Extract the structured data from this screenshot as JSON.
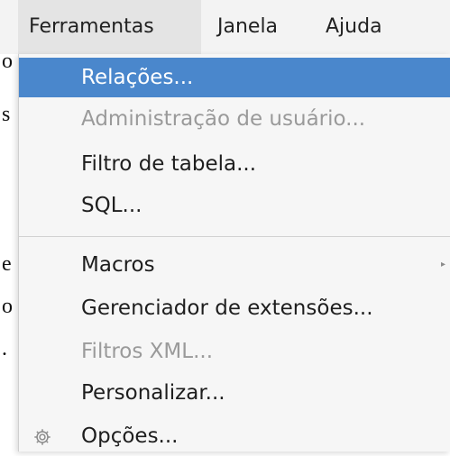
{
  "background_document": {
    "fragments": [
      "o",
      "s",
      "e",
      "o",
      "."
    ]
  },
  "menubar": {
    "items": [
      {
        "label": "Ferramentas",
        "active": true
      },
      {
        "label": "Janela",
        "active": false
      },
      {
        "label": "Ajuda",
        "active": false
      }
    ]
  },
  "tools_menu": {
    "items": [
      {
        "label": "Relações...",
        "state": "highlighted"
      },
      {
        "label": "Administração de usuário...",
        "state": "disabled"
      },
      {
        "label": "Filtro de tabela...",
        "state": "enabled"
      },
      {
        "label": "SQL...",
        "state": "enabled"
      },
      {
        "label": "Macros",
        "state": "enabled",
        "submenu": true
      },
      {
        "label": "Gerenciador de extensões...",
        "state": "enabled"
      },
      {
        "label": "Filtros XML...",
        "state": "disabled"
      },
      {
        "label": "Personalizar...",
        "state": "enabled"
      },
      {
        "label": "Opções...",
        "state": "enabled",
        "icon": "gear-icon"
      }
    ],
    "submenu_arrow": "▸"
  },
  "colors": {
    "highlight": "#4a87cc",
    "menu_background": "#f6f6f6",
    "menubar_background": "#f3f3f3",
    "disabled_text": "#9a9a9a"
  }
}
